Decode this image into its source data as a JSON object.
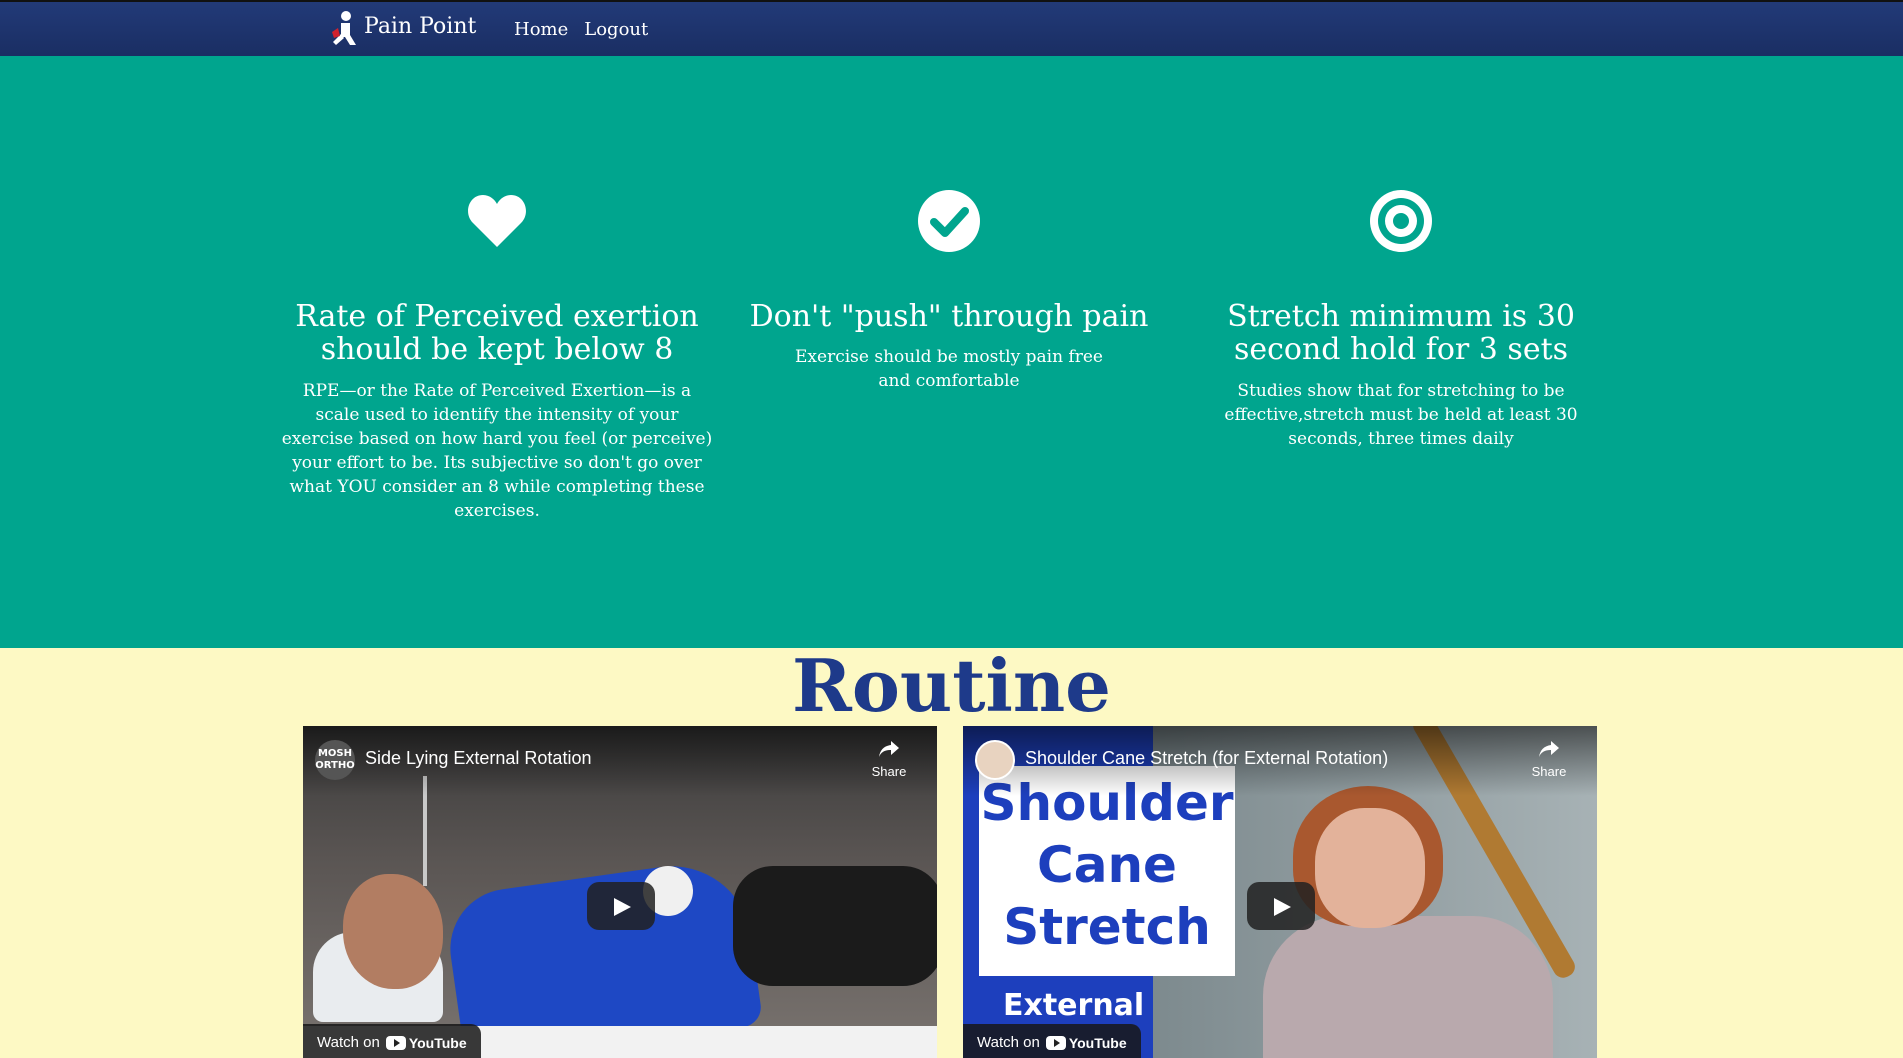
{
  "nav": {
    "brand": "Pain Point",
    "links": [
      "Home",
      "Logout"
    ]
  },
  "features": [
    {
      "icon": "heart-icon",
      "title": "Rate of Perceived exertion should be kept below 8",
      "text": "RPE—or the Rate of Perceived Exertion—is a scale used to identify the intensity of your exercise based on how hard you feel (or perceive) your effort to be. Its subjective so don't go over what YOU consider an 8 while completing these exercises."
    },
    {
      "icon": "check-circle-icon",
      "title": "Don't \"push\" through pain",
      "text": "Exercise should be mostly pain free and comfortable"
    },
    {
      "icon": "target-icon",
      "title": "Stretch minimum is 30 second hold for 3 sets",
      "text": "Studies show that for stretching to be effective,stretch must be held at least 30 seconds, three times daily"
    }
  ],
  "routine": {
    "title": "Routine",
    "videos": [
      {
        "title": "Side Lying External Rotation",
        "channel": "MOSH ORTHO",
        "share": "Share",
        "watch_on": "Watch on",
        "youtube": "YouTube"
      },
      {
        "title": "Shoulder Cane Stretch (for External Rotation)",
        "share": "Share",
        "watch_on": "Watch on",
        "youtube": "YouTube",
        "thumbnail_text": "Shoulder Cane Stretch",
        "thumbnail_sub": "External"
      }
    ]
  },
  "colors": {
    "navbar": "#1e3470",
    "hero": "#00a58e",
    "routine_bg": "#fdf9c4",
    "routine_title": "#1e3a8a"
  }
}
